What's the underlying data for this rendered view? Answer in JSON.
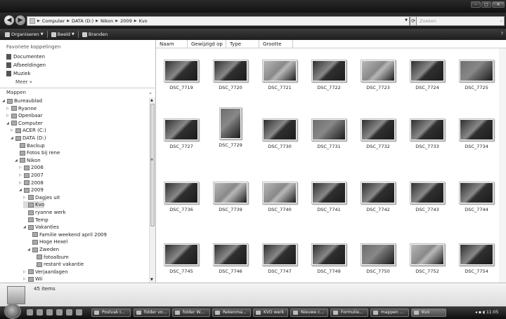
{
  "address": {
    "crumbs": [
      "Computer",
      "DATA (D:)",
      "Nikon",
      "2009",
      "Kvo"
    ]
  },
  "search": {
    "placeholder": "Zoeken"
  },
  "toolbar": {
    "organize": "Organiseren",
    "view": "Beeld",
    "burn": "Branden"
  },
  "nav": {
    "favorites_title": "Favoriete koppelingen",
    "favorites": [
      "Documenten",
      "Afbeeldingen",
      "Muziek"
    ],
    "more": "Meer",
    "folders_title": "Mappen",
    "tree": [
      {
        "label": "Bureaublad",
        "level": 0,
        "exp": "open"
      },
      {
        "label": "Ryanne",
        "level": 1,
        "exp": "closed"
      },
      {
        "label": "Openbaar",
        "level": 1,
        "exp": "closed"
      },
      {
        "label": "Computer",
        "level": 1,
        "exp": "open"
      },
      {
        "label": "ACER (C:)",
        "level": 2,
        "exp": "closed"
      },
      {
        "label": "DATA (D:)",
        "level": 2,
        "exp": "open"
      },
      {
        "label": "Backup",
        "level": 3,
        "exp": ""
      },
      {
        "label": "Fotos bij rene",
        "level": 3,
        "exp": ""
      },
      {
        "label": "Nikon",
        "level": 3,
        "exp": "open"
      },
      {
        "label": "2006",
        "level": 4,
        "exp": "closed"
      },
      {
        "label": "2007",
        "level": 4,
        "exp": "closed"
      },
      {
        "label": "2008",
        "level": 4,
        "exp": "closed"
      },
      {
        "label": "2009",
        "level": 4,
        "exp": "open"
      },
      {
        "label": "Dagjes uit",
        "level": 5,
        "exp": "closed"
      },
      {
        "label": "Kvo",
        "level": 5,
        "exp": "",
        "selected": true
      },
      {
        "label": "ryanne werk",
        "level": 5,
        "exp": ""
      },
      {
        "label": "Temp",
        "level": 5,
        "exp": ""
      },
      {
        "label": "Vakanties",
        "level": 5,
        "exp": "open"
      },
      {
        "label": "Familie weekend april 2009",
        "level": 6,
        "exp": ""
      },
      {
        "label": "Hoge Hexel",
        "level": 6,
        "exp": ""
      },
      {
        "label": "Zweden",
        "level": 6,
        "exp": "open"
      },
      {
        "label": "fotoalbum",
        "level": 7,
        "exp": ""
      },
      {
        "label": "restant vakantie",
        "level": 7,
        "exp": ""
      },
      {
        "label": "Verjaardagen",
        "level": 5,
        "exp": "closed"
      },
      {
        "label": "Wii",
        "level": 5,
        "exp": "closed"
      }
    ]
  },
  "columns": [
    "Naam",
    "Gewijzigd op",
    "Type",
    "Grootte"
  ],
  "files": [
    {
      "name": "DSC_7719",
      "orient": "land",
      "tone": "dark"
    },
    {
      "name": "DSC_7720",
      "orient": "land",
      "tone": "dark"
    },
    {
      "name": "DSC_7721",
      "orient": "land",
      "tone": "light"
    },
    {
      "name": "DSC_7722",
      "orient": "land",
      "tone": "dark"
    },
    {
      "name": "DSC_7723",
      "orient": "land",
      "tone": "light"
    },
    {
      "name": "DSC_7724",
      "orient": "land",
      "tone": "dark"
    },
    {
      "name": "DSC_7725",
      "orient": "land",
      "tone": "mid"
    },
    {
      "name": "DSC_7727",
      "orient": "land",
      "tone": "dark"
    },
    {
      "name": "DSC_7729",
      "orient": "port",
      "tone": "mid"
    },
    {
      "name": "DSC_7730",
      "orient": "land",
      "tone": "dark"
    },
    {
      "name": "DSC_7731",
      "orient": "land",
      "tone": "mid"
    },
    {
      "name": "DSC_7732",
      "orient": "land",
      "tone": "dark"
    },
    {
      "name": "DSC_7733",
      "orient": "land",
      "tone": "dark"
    },
    {
      "name": "DSC_7734",
      "orient": "land",
      "tone": "dark"
    },
    {
      "name": "DSC_7736",
      "orient": "land",
      "tone": "dark"
    },
    {
      "name": "DSC_7739",
      "orient": "land",
      "tone": "light"
    },
    {
      "name": "DSC_7740",
      "orient": "land",
      "tone": "light"
    },
    {
      "name": "DSC_7741",
      "orient": "land",
      "tone": "dark"
    },
    {
      "name": "DSC_7742",
      "orient": "land",
      "tone": "dark"
    },
    {
      "name": "DSC_7743",
      "orient": "land",
      "tone": "dark"
    },
    {
      "name": "DSC_7744",
      "orient": "land",
      "tone": "dark"
    },
    {
      "name": "DSC_7745",
      "orient": "land",
      "tone": "dark"
    },
    {
      "name": "DSC_7746",
      "orient": "land",
      "tone": "dark"
    },
    {
      "name": "DSC_7747",
      "orient": "land",
      "tone": "dark"
    },
    {
      "name": "DSC_7749",
      "orient": "land",
      "tone": "dark"
    },
    {
      "name": "DSC_7750",
      "orient": "land",
      "tone": "mid"
    },
    {
      "name": "DSC_7752",
      "orient": "land",
      "tone": "light"
    },
    {
      "name": "DSC_7754",
      "orient": "land",
      "tone": "dark"
    }
  ],
  "status": {
    "count": "45 items"
  },
  "taskbar": {
    "buttons": [
      "Postvak I...",
      "folder vo...",
      "folder W...",
      "Rekenma...",
      "KVO werk",
      "Nieuwe c...",
      "Formulie...",
      "mappen ...",
      "Kvo"
    ],
    "active": "Kvo",
    "clock": "11:05"
  },
  "colors": {
    "dark": "#2f2f2f",
    "mid": "#6e6e6e",
    "light": "#b8b8b8"
  }
}
